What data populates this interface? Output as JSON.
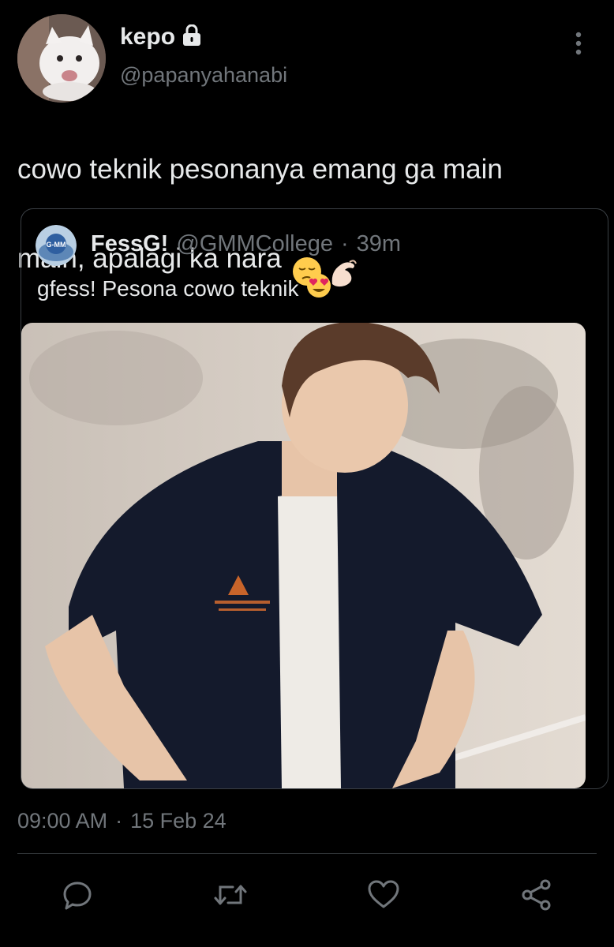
{
  "tweet": {
    "display_name": "kepo",
    "handle": "@papanyahanabi",
    "text_line1": "cowo teknik pesonanya emang ga main",
    "text_line2": "main, apalagi ka nara",
    "emojis": [
      "pensive-face",
      "pinching-hand"
    ],
    "timestamp_time": "09:00 AM",
    "timestamp_sep": "·",
    "timestamp_date": "15 Feb 24"
  },
  "quote": {
    "avatar_text": "G-MM",
    "display_name": "FessG!",
    "handle": "@GMMCollege",
    "sep": "·",
    "time": "39m",
    "text": "gfess! Pesona cowo teknik",
    "emoji": "heart-eyes-face"
  },
  "actions": {
    "reply_icon": "reply-icon",
    "retweet_icon": "retweet-icon",
    "like_icon": "heart-icon",
    "share_icon": "share-icon"
  },
  "colors": {
    "background": "#000000",
    "text_primary": "#e7e9ea",
    "text_secondary": "#71767b",
    "border": "#3a3f44"
  }
}
